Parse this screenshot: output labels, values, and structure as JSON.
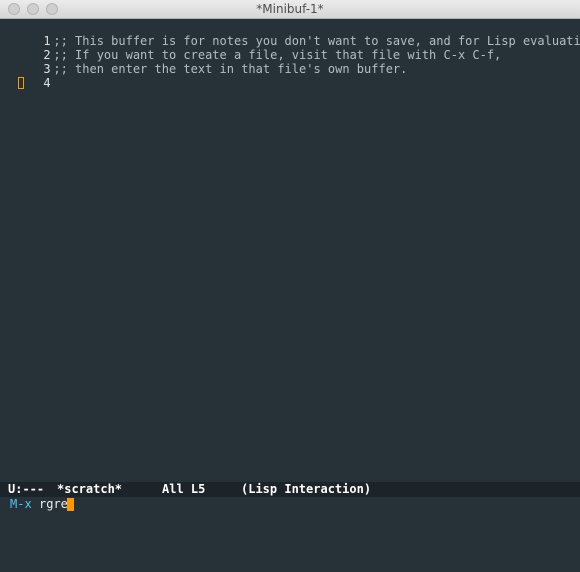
{
  "window": {
    "title": "*Minibuf-1*"
  },
  "buffer": {
    "lines": [
      {
        "number": "1",
        "text": ";; This buffer is for notes you don't want to save, and for Lisp evaluation."
      },
      {
        "number": "2",
        "text": ";; If you want to create a file, visit that file with C-x C-f,"
      },
      {
        "number": "3",
        "text": ";; then enter the text in that file's own buffer."
      },
      {
        "number": "4",
        "text": ""
      }
    ]
  },
  "modeline": {
    "status": "U:---",
    "buffer_name": "*scratch*",
    "position": "All L5",
    "mode": "(Lisp Interaction)"
  },
  "minibuffer": {
    "prompt": "M-x",
    "input": "rgre"
  },
  "colors": {
    "background": "#263238",
    "cursor": "#ff9800",
    "prompt": "#4fc3f7"
  }
}
